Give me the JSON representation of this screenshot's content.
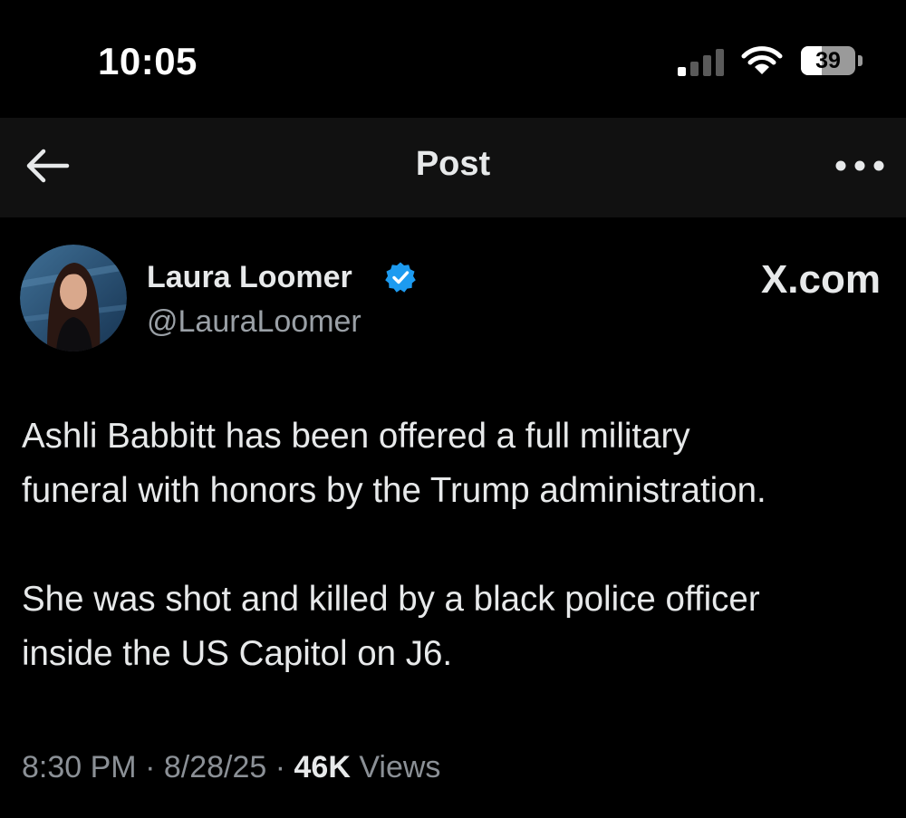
{
  "status_bar": {
    "time": "10:05",
    "battery_percent": "39",
    "battery_level": 0.39,
    "signal_bars_active": 1,
    "signal_bars_total": 4,
    "icons": [
      "cellular-signal-icon",
      "wifi-icon",
      "battery-icon"
    ]
  },
  "nav": {
    "title": "Post",
    "back_icon": "arrow-left-icon",
    "more_icon": "ellipsis-icon"
  },
  "post": {
    "author": {
      "name": "Laura Loomer",
      "handle": "@LauraLoomer",
      "verified": true,
      "verified_badge_color": "#1d9bf0"
    },
    "watermark": "X.com",
    "text": [
      "Ashli Babbitt has been offered a full military",
      "funeral with honors by the Trump administration.",
      "She was shot and killed by a black police officer",
      "inside the US Capitol on J6."
    ],
    "meta": {
      "time": "8:30 PM",
      "separator": " · ",
      "date": "8/28/25",
      "views_count": "46K",
      "views_label": " Views"
    }
  },
  "colors": {
    "background": "#000000",
    "nav_background": "#111111",
    "primary_text": "#e7e9ea",
    "secondary_text": "#8b9096",
    "accent": "#1d9bf0"
  }
}
